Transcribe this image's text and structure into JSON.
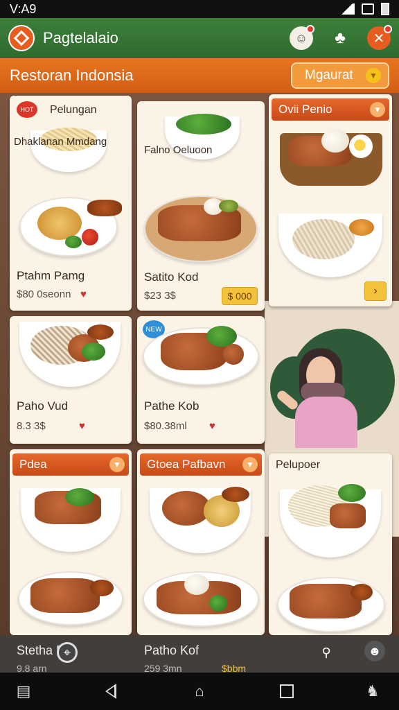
{
  "status_bar": {
    "time": "V:A9"
  },
  "app_bar": {
    "title": "Pagtelalaio",
    "icons": [
      "logo-diamond-icon",
      "face-icon",
      "person-icon",
      "close-icon"
    ]
  },
  "sub_bar": {
    "title": "Restoran Indonsia",
    "button_label": "Mgaurat"
  },
  "cards": [
    {
      "title": "Pelungan",
      "subtitle": "Dhaklanan Mmdang",
      "badge": "HOT",
      "name": "Ptahm Pamg",
      "price": "$80 0seonn"
    },
    {
      "title": "Falno Oeluoon",
      "name": "Satito Kod",
      "price": "$23 3$",
      "price_button": "$ 000"
    },
    {
      "title": "Ovii Penio"
    },
    {
      "name": "Paho Vud",
      "price": "8.3 3$"
    },
    {
      "badge": "NEW",
      "name": "Pathe Kob",
      "price": "$80.38ml"
    },
    {
      "title": "Pdea"
    },
    {
      "title": "Gtoea Pafbavn"
    },
    {
      "title": "Pelupoer"
    }
  ],
  "bottom_overlay": {
    "items": [
      {
        "name": "Stetha Pm",
        "price": "9.8 arn"
      },
      {
        "name": "Patho Kof",
        "price": "259 3mn",
        "button": "$bbm"
      }
    ]
  },
  "colors": {
    "green": "#2f6a2f",
    "orange": "#e8751f",
    "cream": "#fbf3e6",
    "yellow": "#f4c23a"
  }
}
